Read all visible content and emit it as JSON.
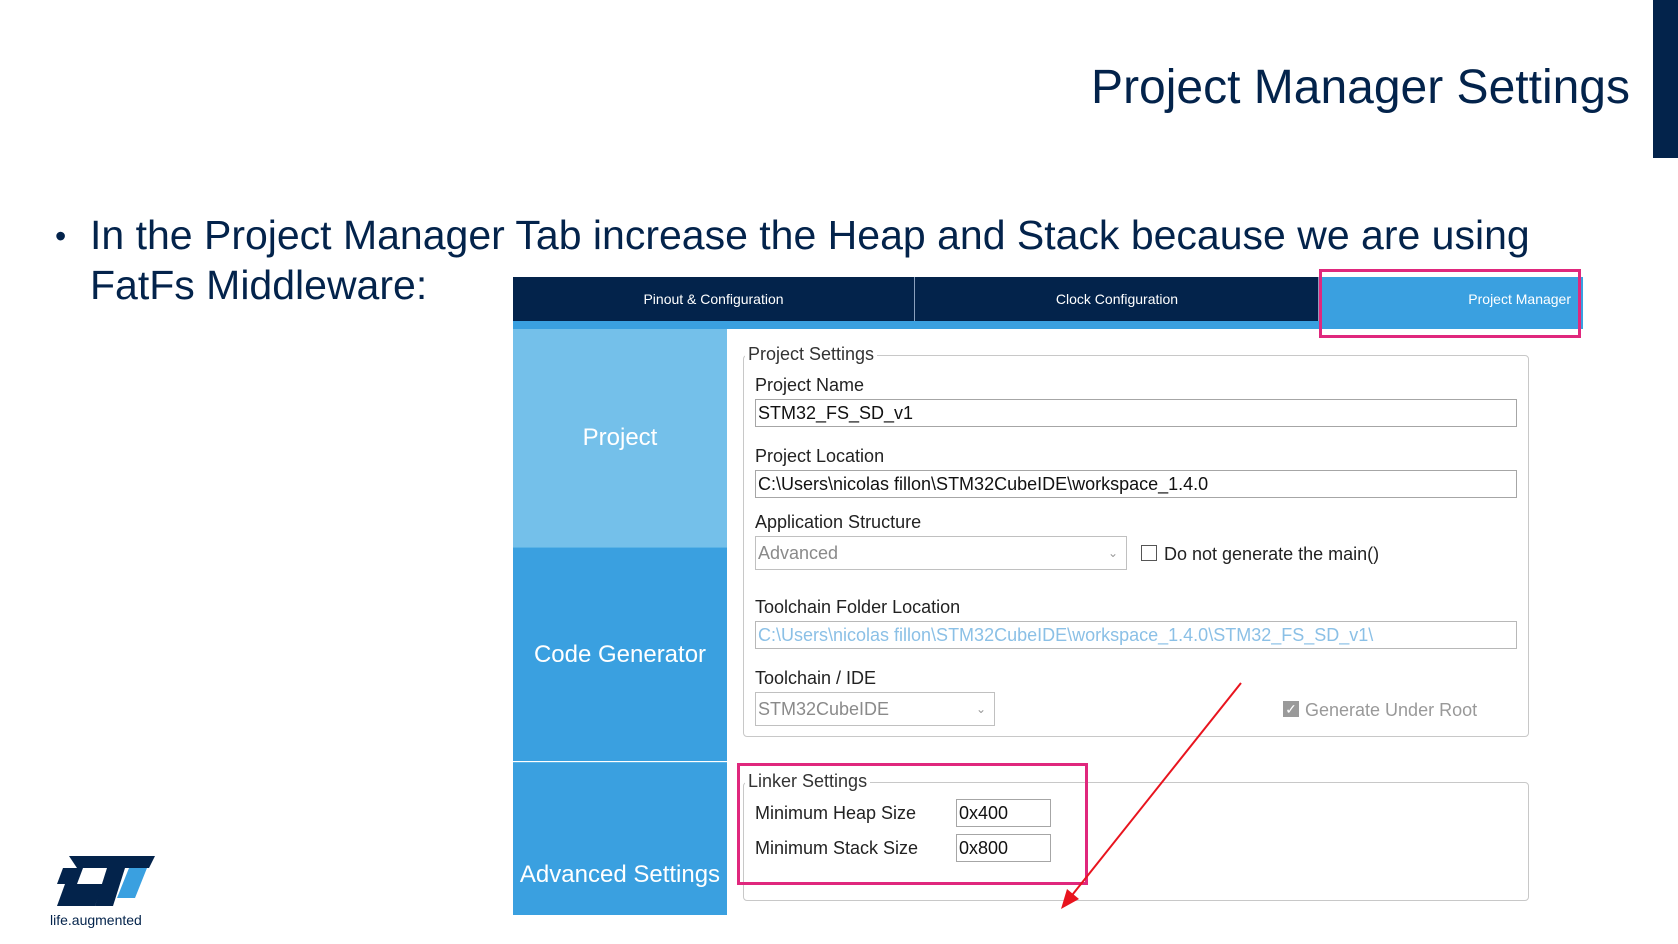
{
  "slide": {
    "title": "Project Manager Settings",
    "bullet": "In the Project Manager Tab increase the Heap and Stack because we are using FatFs Middleware:",
    "logo_tagline": "life.augmented"
  },
  "tabs": [
    {
      "label": "Pinout & Configuration"
    },
    {
      "label": "Clock Configuration"
    },
    {
      "label": "Project Manager",
      "active": true
    }
  ],
  "sidebar": {
    "items": [
      {
        "label": "Project",
        "active": true
      },
      {
        "label": "Code Generator"
      },
      {
        "label": "Advanced Settings"
      }
    ]
  },
  "project_settings": {
    "legend": "Project Settings",
    "project_name_label": "Project Name",
    "project_name_value": "STM32_FS_SD_v1",
    "project_location_label": "Project Location",
    "project_location_value": "C:\\Users\\nicolas fillon\\STM32CubeIDE\\workspace_1.4.0",
    "app_structure_label": "Application Structure",
    "app_structure_value": "Advanced",
    "no_main_label": "Do not generate the main()",
    "no_main_checked": false,
    "toolchain_folder_label": "Toolchain Folder Location",
    "toolchain_folder_value": "C:\\Users\\nicolas fillon\\STM32CubeIDE\\workspace_1.4.0\\STM32_FS_SD_v1\\",
    "toolchain_ide_label": "Toolchain / IDE",
    "toolchain_ide_value": "STM32CubeIDE",
    "generate_under_root_label": "Generate Under Root",
    "generate_under_root_checked": true
  },
  "linker_settings": {
    "legend": "Linker Settings",
    "min_heap_label": "Minimum Heap Size",
    "min_heap_value": "0x400",
    "min_stack_label": "Minimum Stack Size",
    "min_stack_value": "0x800"
  },
  "colors": {
    "navy": "#03234b",
    "accent_blue": "#3aa0e0",
    "light_blue": "#74c0ea",
    "highlight_pink": "#e0287d",
    "arrow_red": "#e8141e"
  }
}
